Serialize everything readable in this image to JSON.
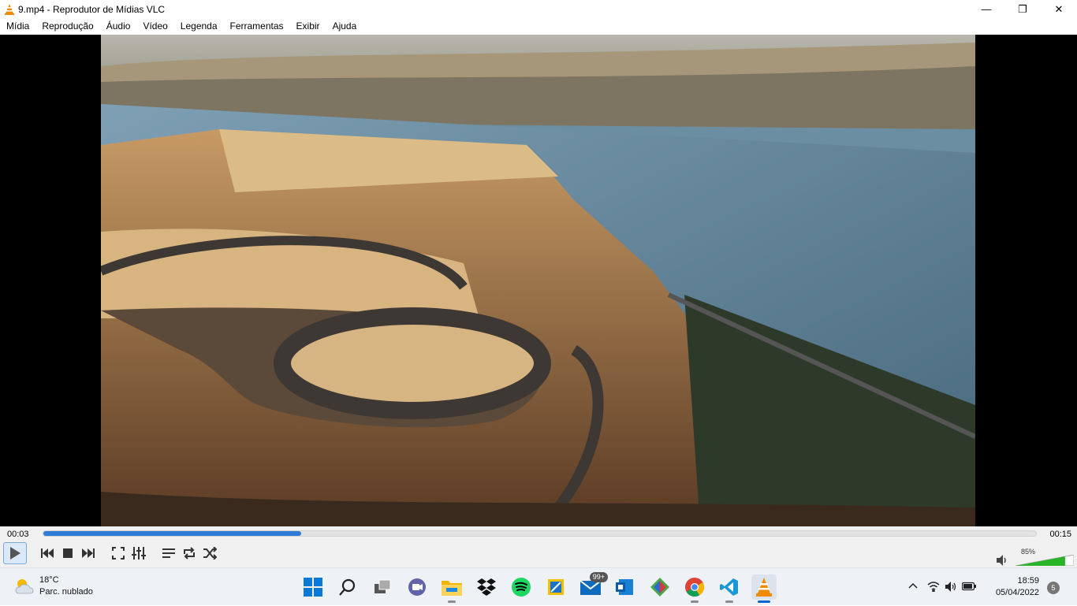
{
  "window": {
    "title": "9.mp4 - Reprodutor de Mídias VLC",
    "minimize_glyph": "—",
    "maximize_glyph": "❐",
    "close_glyph": "✕"
  },
  "menu": [
    "Mídia",
    "Reprodução",
    "Áudio",
    "Vídeo",
    "Legenda",
    "Ferramentas",
    "Exibir",
    "Ajuda"
  ],
  "player": {
    "elapsed": "00:03",
    "total": "00:15",
    "progress_fraction": 0.26,
    "volume_percent": "85%",
    "volume_fraction": 0.85,
    "accent_color": "#2f7cd6",
    "volume_color": "#28b428",
    "buttons": [
      "play-icon",
      "previous-icon",
      "stop-icon",
      "next-icon",
      "fullscreen-icon",
      "extended-settings-icon",
      "playlist-icon",
      "loop-icon",
      "shuffle-icon"
    ]
  },
  "taskbar": {
    "weather_temp": "18°C",
    "weather_desc": "Parc. nublado",
    "mail_badge": "99+",
    "time": "18:59",
    "date": "05/04/2022",
    "notifications": "5",
    "apps": [
      "start-icon",
      "search-icon",
      "task-view-icon",
      "teams-chat-icon",
      "file-explorer-icon",
      "dropbox-icon",
      "spotify-icon",
      "snip-tool-icon",
      "mail-icon",
      "outlook-icon",
      "git-icon",
      "chrome-icon",
      "vscode-icon",
      "vlc-icon"
    ]
  }
}
